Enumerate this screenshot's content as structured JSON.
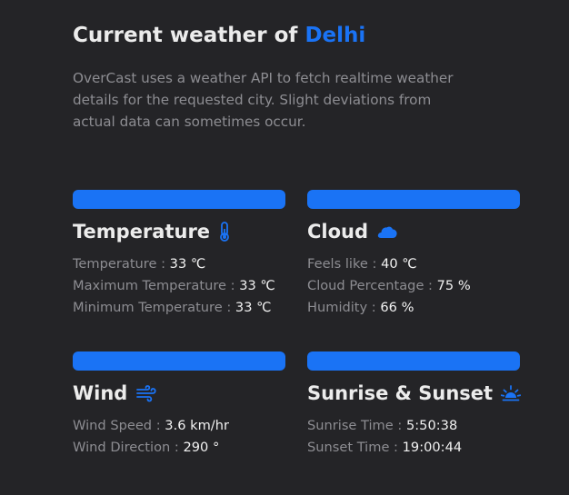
{
  "title": {
    "prefix": "Current weather of",
    "city": "Delhi"
  },
  "intro": "OverCast uses a weather API to fetch realtime weather details for the requested city. Slight deviations from actual data can sometimes occur.",
  "colors": {
    "background": "#242427",
    "accent": "#1a73f5",
    "muted_text": "#8d8d92",
    "text": "#ececec"
  },
  "cards": {
    "temperature": {
      "title": "Temperature",
      "icon": "thermometer-icon",
      "rows": [
        {
          "label": "Temperature",
          "value": "33 ℃"
        },
        {
          "label": "Maximum Temperature",
          "value": "33 ℃"
        },
        {
          "label": "Minimum Temperature",
          "value": "33 ℃"
        }
      ]
    },
    "cloud": {
      "title": "Cloud",
      "icon": "cloud-icon",
      "rows": [
        {
          "label": "Feels like",
          "value": "40 ℃"
        },
        {
          "label": "Cloud Percentage",
          "value": "75 %"
        },
        {
          "label": "Humidity",
          "value": "66 %"
        }
      ]
    },
    "wind": {
      "title": "Wind",
      "icon": "wind-icon",
      "rows": [
        {
          "label": "Wind Speed",
          "value": "3.6 km/hr"
        },
        {
          "label": "Wind Direction",
          "value": "290 °"
        }
      ]
    },
    "sun": {
      "title": "Sunrise & Sunset",
      "icon": "sunrise-icon",
      "rows": [
        {
          "label": "Sunrise Time",
          "value": "5:50:38"
        },
        {
          "label": "Sunset Time",
          "value": "19:00:44"
        }
      ]
    }
  },
  "separator": " : "
}
